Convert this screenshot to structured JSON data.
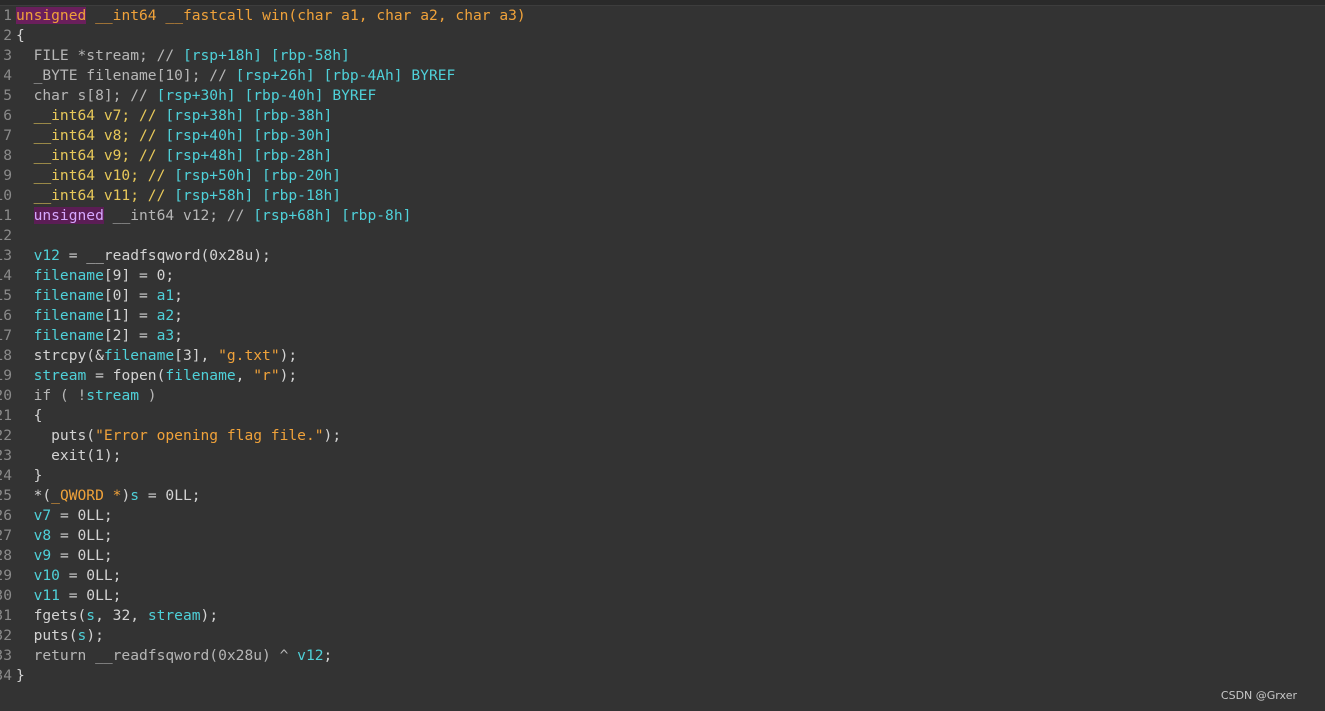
{
  "lines": [
    {
      "n": "1",
      "segs": [
        {
          "t": "unsigned",
          "c": "kw-hl"
        },
        {
          "t": " ",
          "c": "plain"
        },
        {
          "t": "__int64",
          "c": "kw"
        },
        {
          "t": " ",
          "c": "plain"
        },
        {
          "t": "__fastcall",
          "c": "kw"
        },
        {
          "t": " win(",
          "c": "kw"
        },
        {
          "t": "char",
          "c": "kw"
        },
        {
          "t": " a1, ",
          "c": "kw"
        },
        {
          "t": "char",
          "c": "kw"
        },
        {
          "t": " a2, ",
          "c": "kw"
        },
        {
          "t": "char",
          "c": "kw"
        },
        {
          "t": " a3)",
          "c": "kw"
        }
      ]
    },
    {
      "n": "2",
      "segs": [
        {
          "t": "{",
          "c": "plain"
        }
      ]
    },
    {
      "n": "3",
      "segs": [
        {
          "t": "  FILE *stream; // ",
          "c": "cm"
        },
        {
          "t": "[rsp+18h] [rbp-58h]",
          "c": "addr"
        }
      ]
    },
    {
      "n": "4",
      "segs": [
        {
          "t": "  _BYTE filename[10]; // ",
          "c": "cm"
        },
        {
          "t": "[rsp+26h] [rbp-4Ah] BYREF",
          "c": "addr"
        }
      ]
    },
    {
      "n": "5",
      "segs": [
        {
          "t": "  char s[8]; // ",
          "c": "cm"
        },
        {
          "t": "[rsp+30h] [rbp-40h] BYREF",
          "c": "addr"
        }
      ]
    },
    {
      "n": "6",
      "segs": [
        {
          "t": "  __int64 v7; // ",
          "c": "yellow"
        },
        {
          "t": "[rsp+38h] [rbp-38h]",
          "c": "addr"
        }
      ]
    },
    {
      "n": "7",
      "segs": [
        {
          "t": "  __int64 v8; // ",
          "c": "yellow"
        },
        {
          "t": "[rsp+40h] [rbp-30h]",
          "c": "addr"
        }
      ]
    },
    {
      "n": "8",
      "segs": [
        {
          "t": "  __int64 v9; // ",
          "c": "yellow"
        },
        {
          "t": "[rsp+48h] [rbp-28h]",
          "c": "addr"
        }
      ]
    },
    {
      "n": "9",
      "segs": [
        {
          "t": "  __int64 v10; // ",
          "c": "yellow"
        },
        {
          "t": "[rsp+50h] [rbp-20h]",
          "c": "addr"
        }
      ]
    },
    {
      "n": "10",
      "segs": [
        {
          "t": "  __int64 v11; // ",
          "c": "yellow"
        },
        {
          "t": "[rsp+58h] [rbp-18h]",
          "c": "addr"
        }
      ]
    },
    {
      "n": "11",
      "segs": [
        {
          "t": "  ",
          "c": "plain"
        },
        {
          "t": "unsigned",
          "c": "purple-bg"
        },
        {
          "t": " __int64 v12; // ",
          "c": "cm"
        },
        {
          "t": "[rsp+68h] [rbp-8h]",
          "c": "addr"
        }
      ]
    },
    {
      "n": "12",
      "segs": [
        {
          "t": "",
          "c": "plain"
        }
      ]
    },
    {
      "n": "13",
      "segs": [
        {
          "t": "  ",
          "c": "plain"
        },
        {
          "t": "v12",
          "c": "var"
        },
        {
          "t": " = __readfsqword(0x28u);",
          "c": "plain"
        }
      ]
    },
    {
      "n": "14",
      "segs": [
        {
          "t": "  ",
          "c": "plain"
        },
        {
          "t": "filename",
          "c": "var"
        },
        {
          "t": "[9] = 0;",
          "c": "plain"
        }
      ]
    },
    {
      "n": "15",
      "segs": [
        {
          "t": "  ",
          "c": "plain"
        },
        {
          "t": "filename",
          "c": "var"
        },
        {
          "t": "[0] = ",
          "c": "plain"
        },
        {
          "t": "a1",
          "c": "var"
        },
        {
          "t": ";",
          "c": "plain"
        }
      ]
    },
    {
      "n": "16",
      "segs": [
        {
          "t": "  ",
          "c": "plain"
        },
        {
          "t": "filename",
          "c": "var"
        },
        {
          "t": "[1] = ",
          "c": "plain"
        },
        {
          "t": "a2",
          "c": "var"
        },
        {
          "t": ";",
          "c": "plain"
        }
      ]
    },
    {
      "n": "17",
      "segs": [
        {
          "t": "  ",
          "c": "plain"
        },
        {
          "t": "filename",
          "c": "var"
        },
        {
          "t": "[2] = ",
          "c": "plain"
        },
        {
          "t": "a3",
          "c": "var"
        },
        {
          "t": ";",
          "c": "plain"
        }
      ]
    },
    {
      "n": "18",
      "segs": [
        {
          "t": "  strcpy(&",
          "c": "plain"
        },
        {
          "t": "filename",
          "c": "var"
        },
        {
          "t": "[3], ",
          "c": "plain"
        },
        {
          "t": "\"g.txt\"",
          "c": "str"
        },
        {
          "t": ");",
          "c": "plain"
        }
      ]
    },
    {
      "n": "19",
      "segs": [
        {
          "t": "  ",
          "c": "plain"
        },
        {
          "t": "stream",
          "c": "var"
        },
        {
          "t": " = fopen(",
          "c": "plain"
        },
        {
          "t": "filename",
          "c": "var"
        },
        {
          "t": ", ",
          "c": "plain"
        },
        {
          "t": "\"r\"",
          "c": "str"
        },
        {
          "t": ");",
          "c": "plain"
        }
      ]
    },
    {
      "n": "20",
      "segs": [
        {
          "t": "  if ( !",
          "c": "cm"
        },
        {
          "t": "stream",
          "c": "var"
        },
        {
          "t": " )",
          "c": "cm"
        }
      ]
    },
    {
      "n": "21",
      "segs": [
        {
          "t": "  {",
          "c": "plain"
        }
      ]
    },
    {
      "n": "22",
      "segs": [
        {
          "t": "    puts(",
          "c": "plain"
        },
        {
          "t": "\"Error opening flag file.\"",
          "c": "str"
        },
        {
          "t": ");",
          "c": "plain"
        }
      ]
    },
    {
      "n": "23",
      "segs": [
        {
          "t": "    exit(1);",
          "c": "plain"
        }
      ]
    },
    {
      "n": "24",
      "segs": [
        {
          "t": "  }",
          "c": "plain"
        }
      ]
    },
    {
      "n": "25",
      "segs": [
        {
          "t": "  *(",
          "c": "plain"
        },
        {
          "t": "_QWORD *",
          "c": "kw"
        },
        {
          "t": ")",
          "c": "plain"
        },
        {
          "t": "s",
          "c": "var"
        },
        {
          "t": " = 0LL;",
          "c": "plain"
        }
      ]
    },
    {
      "n": "26",
      "segs": [
        {
          "t": "  ",
          "c": "plain"
        },
        {
          "t": "v7",
          "c": "var"
        },
        {
          "t": " = 0LL;",
          "c": "plain"
        }
      ]
    },
    {
      "n": "27",
      "segs": [
        {
          "t": "  ",
          "c": "plain"
        },
        {
          "t": "v8",
          "c": "var"
        },
        {
          "t": " = 0LL;",
          "c": "plain"
        }
      ]
    },
    {
      "n": "28",
      "segs": [
        {
          "t": "  ",
          "c": "plain"
        },
        {
          "t": "v9",
          "c": "var"
        },
        {
          "t": " = 0LL;",
          "c": "plain"
        }
      ]
    },
    {
      "n": "29",
      "segs": [
        {
          "t": "  ",
          "c": "plain"
        },
        {
          "t": "v10",
          "c": "var"
        },
        {
          "t": " = 0LL;",
          "c": "plain"
        }
      ]
    },
    {
      "n": "30",
      "segs": [
        {
          "t": "  ",
          "c": "plain"
        },
        {
          "t": "v11",
          "c": "var"
        },
        {
          "t": " = 0LL;",
          "c": "plain"
        }
      ]
    },
    {
      "n": "31",
      "segs": [
        {
          "t": "  fgets(",
          "c": "plain"
        },
        {
          "t": "s",
          "c": "var"
        },
        {
          "t": ", 32, ",
          "c": "plain"
        },
        {
          "t": "stream",
          "c": "var"
        },
        {
          "t": ");",
          "c": "plain"
        }
      ]
    },
    {
      "n": "32",
      "segs": [
        {
          "t": "  puts(",
          "c": "plain"
        },
        {
          "t": "s",
          "c": "var"
        },
        {
          "t": ");",
          "c": "plain"
        }
      ]
    },
    {
      "n": "33",
      "segs": [
        {
          "t": "  return __readfsqword(0x28u) ^ ",
          "c": "cm"
        },
        {
          "t": "v12",
          "c": "var"
        },
        {
          "t": ";",
          "c": "plain"
        }
      ]
    },
    {
      "n": "34",
      "segs": [
        {
          "t": "}",
          "c": "plain"
        }
      ]
    }
  ],
  "watermark": "CSDN @Grxer",
  "colors": {
    "background": "#333333",
    "keyword": "#f0a23a",
    "variable": "#4fd1d9",
    "string": "#f0a23a",
    "highlight": "#6a1f5c"
  }
}
